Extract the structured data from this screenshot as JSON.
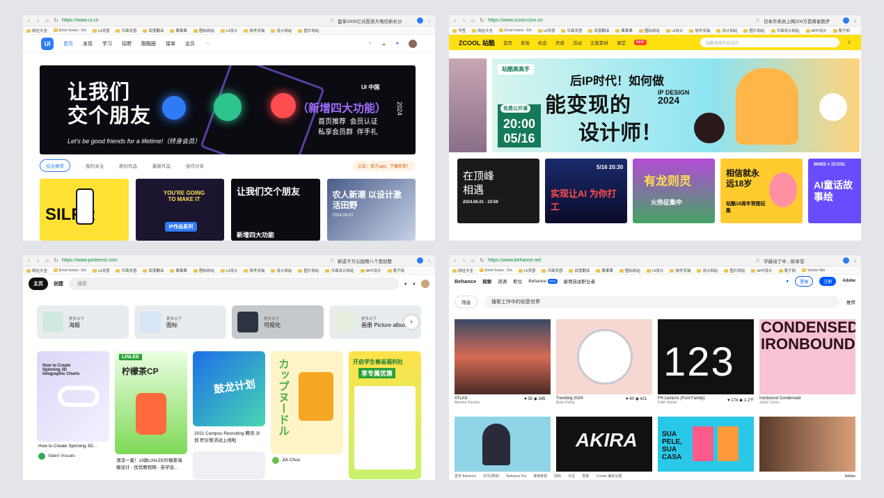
{
  "w1": {
    "url": "https://www.ui.cn",
    "tab_title": "盘享2000亿元投资大电信新长沙",
    "bookmarks": [
      "网址大全",
      "Error Icons - Do",
      "UI灵感",
      "平面灵感",
      "百度翻译",
      "果果果",
      "图标网站",
      "UI设计",
      "软件安装",
      "设计网站",
      "图片网站"
    ],
    "nav": {
      "logo": "UI",
      "items": [
        "首页",
        "发现",
        "学习",
        "招聘",
        "酷酷圈",
        "接单",
        "会员"
      ],
      "more": "···"
    },
    "banner": {
      "headline_1": "让我们",
      "headline_2": "交个朋友",
      "subline": "Let's be good friends for a lifetime!（终身会员）",
      "new_features": "（新增四大功能）",
      "features": [
        "首页推荐",
        "会员认证",
        "私享会员群",
        "伴手礼"
      ],
      "brand": "UI 中国",
      "year": "2024"
    },
    "tabs": [
      "综合推荐",
      "我的关注",
      "原创作品",
      "最新作品",
      "佳作分享"
    ],
    "notice": "公告：官方app，下载有奖！",
    "cards": [
      {
        "title": "SILRR"
      },
      {
        "title": "YOU'RE GOING TO MAKE IT",
        "tag": "IP作品系列"
      },
      {
        "title": "让我们交个朋友",
        "sub": "新增四大功能"
      },
      {
        "title": "农人新潮 以设计激活田野",
        "date": "2024.04.01"
      }
    ]
  },
  "w2": {
    "url": "https://www.zcool.com.cn",
    "tab_title": "日本外卖员上网200万首周星跑步",
    "bookmarks": [
      "书签",
      "网址大全",
      "Error Icons - Do",
      "UI灵感",
      "平面灵感",
      "百度翻译",
      "果果果",
      "图标网站",
      "UI设计",
      "软件安装",
      "设计网站",
      "图片网站",
      "平面设计网站",
      "APP设计",
      "我子网"
    ],
    "nav": {
      "logo": "ZCOOL 站酷",
      "items": [
        "首页",
        "发现",
        "机会",
        "灵感",
        "活动",
        "正版素材",
        "课堂"
      ],
      "search_placeholder": "站酷海报开启设计",
      "badge": "NEW"
    },
    "banner": {
      "badge": "站酷高高手",
      "t1": "后IP时代！如何做",
      "t2": "能变现的",
      "t3": "设计师！",
      "ipd_1": "IP DESIGN",
      "ipd_2": "2024",
      "free": "免费公开课",
      "time": "20:00",
      "date": "05/16"
    },
    "cards": [
      {
        "title": "在顶峰 相遇",
        "sub": "2024.06.01 - 23:59"
      },
      {
        "title": "实现让AI 为你打工",
        "sub": "5/16 20:30"
      },
      {
        "title": "有龙则灵",
        "sub": "火热征集中"
      },
      {
        "title": "相信就永远18岁",
        "sub": "站酷18周年贺图征集"
      },
      {
        "title": "AI童话故事绘",
        "sub": "WHEE × ZCOOL"
      }
    ]
  },
  "w3": {
    "url": "https://www.pinterest.com",
    "tab_title": "新造千万公园用八个黑别墅",
    "bookmarks": [
      "网址大全",
      "Error Icons - Do",
      "UI灵感",
      "平面灵感",
      "百度翻译",
      "果果果",
      "图标网站",
      "UI设计",
      "软件安装",
      "设计网站",
      "图片网站",
      "平面设计网站",
      "APP设计",
      "我子网"
    ],
    "bar": {
      "home": "主页",
      "create": "创建",
      "search_placeholder": "搜索"
    },
    "categories": [
      {
        "small": "更多点子",
        "big": "海报"
      },
      {
        "small": "更多点子",
        "big": "图标"
      },
      {
        "small": "更多点子",
        "big": "可视化"
      },
      {
        "small": "更多点子",
        "big": "画册 Picture album"
      }
    ],
    "pins": [
      {
        "title": "How to Create Spinning 3D...",
        "author": "Valeri Visuals",
        "inner": "How to Create Spinning 3D Infographic Charts"
      },
      {
        "title": "清凉一夏！19款LINLEE柠檬茶海报设计 - 优优教程网 - 自学设...",
        "inner": "柠檬茶CP",
        "brand": "LINLEE"
      },
      {
        "title": "2021 Campus Recruiting 腾讯·计划 积诊暂活动上线啦",
        "inner": "鼓龙计划"
      },
      {
        "title": "JIA Chou",
        "inner": "カップヌードル"
      },
      {
        "title": "开启学生春返福利社",
        "inner": "享专属优惠"
      }
    ]
  },
  "w4": {
    "url": "https://www.behance.net",
    "tab_title": "学鼓动了中…鲜享受",
    "bookmarks": [
      "网址大全",
      "Error Icons - Do",
      "UI灵感",
      "平面灵感",
      "百度翻译",
      "果果果",
      "图标网站",
      "UI设计",
      "软件安装",
      "设计网站",
      "图片网站",
      "APP设计",
      "我子网",
      "Vector Wo"
    ],
    "nav": {
      "logo": "Behance",
      "items": [
        "探索",
        "资源",
        "职位",
        "Behance",
        "雇用自由职业者"
      ],
      "pro": "PRO",
      "login": "登录",
      "signup": "注册",
      "adobe": "Adobe"
    },
    "filter": "筛选",
    "search_placeholder": "搜索工作中的创意世界",
    "sort_label": "推荐",
    "shots": [
      {
        "title": "ATLAS",
        "author": "Maxime Daviron",
        "likes": "35",
        "views": "345"
      },
      {
        "title": "Trending 2024",
        "author": "Bjorn Doerg",
        "likes": "40",
        "views": "421"
      },
      {
        "title": "FH Lecturis (Font Family)",
        "author": "Fatih Hardal",
        "likes": "174",
        "views": "1.2千",
        "inner": "123"
      },
      {
        "title": "Ironbound Condensed",
        "author": "Jason Carne",
        "inner": "CONDENSED IRONBOUND"
      },
      {
        "title": "",
        "author": ""
      },
      {
        "title": "",
        "author": "",
        "inner": "AKIRA"
      },
      {
        "title": "",
        "author": "",
        "inner": "SUA PELE, SUA CASA"
      },
      {
        "title": "",
        "author": ""
      }
    ],
    "footer": [
      "更多 Behance",
      "中文(简体)",
      "Behance Pro",
      "使用条款",
      "隐私",
      "社区",
      "帮助",
      "Cookie 偏好设置"
    ]
  }
}
